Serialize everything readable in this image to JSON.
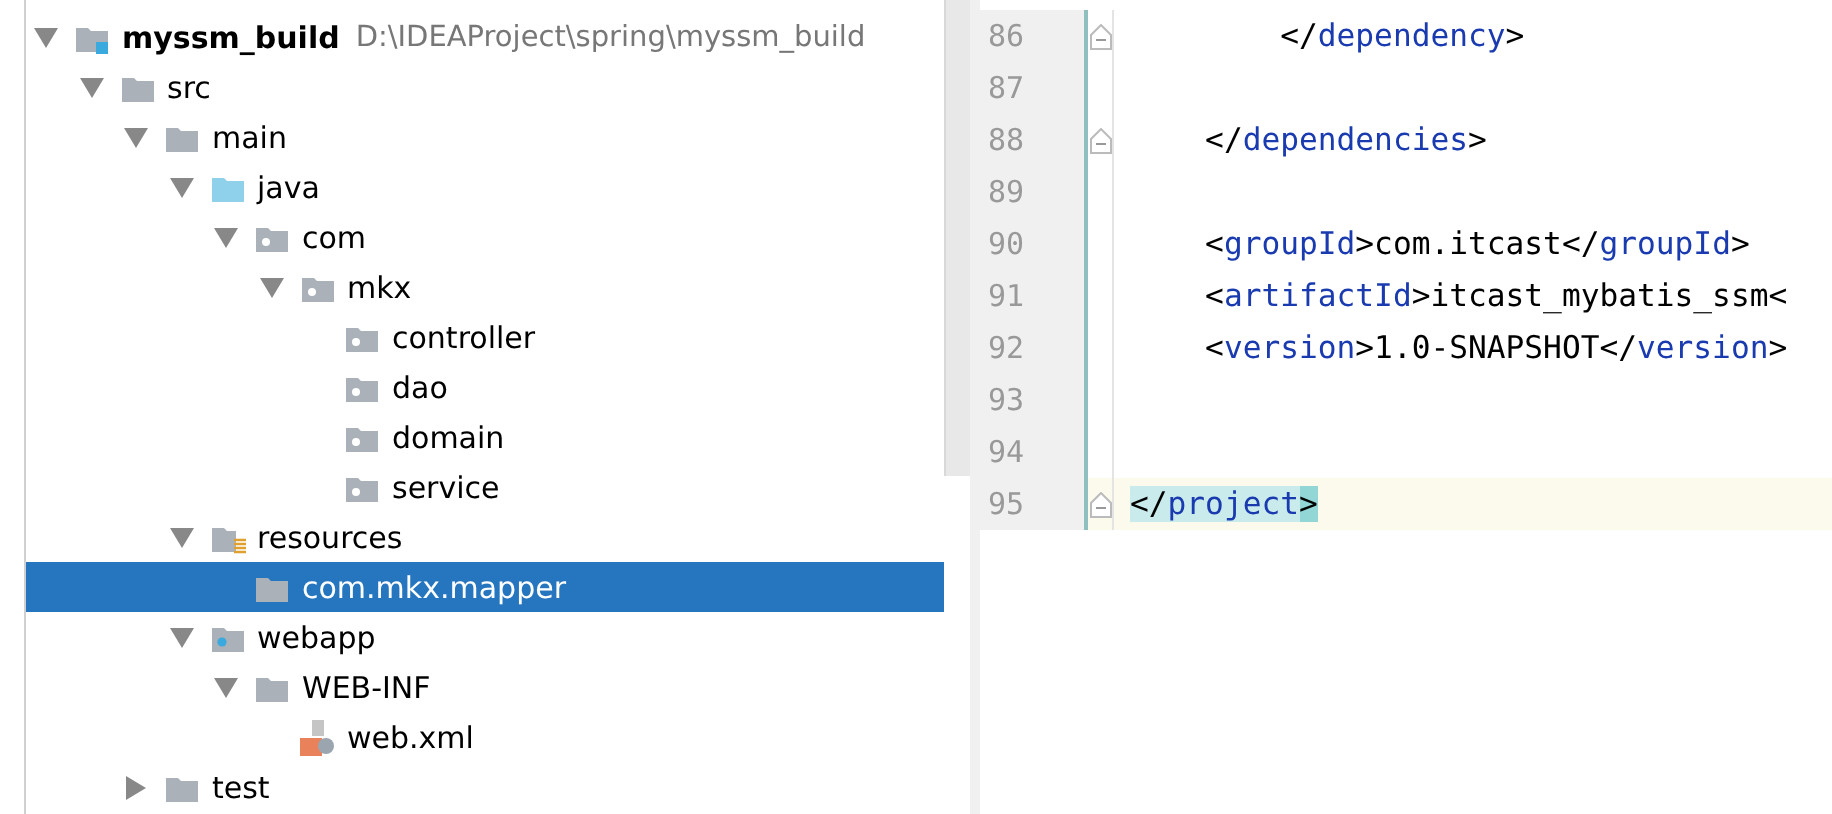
{
  "project_tree": {
    "items": [
      {
        "label": "myssm_build",
        "path": "D:\\IDEAProject\\spring\\myssm_build",
        "kind": "module",
        "expanded": true,
        "selected": false,
        "children": [
          {
            "label": "src",
            "kind": "folder",
            "expanded": true,
            "selected": false,
            "children": [
              {
                "label": "main",
                "kind": "folder",
                "expanded": true,
                "selected": false,
                "children": [
                  {
                    "label": "java",
                    "kind": "source",
                    "expanded": true,
                    "selected": false,
                    "children": [
                      {
                        "label": "com",
                        "kind": "package",
                        "expanded": true,
                        "selected": false,
                        "children": [
                          {
                            "label": "mkx",
                            "kind": "package",
                            "expanded": true,
                            "selected": false,
                            "children": [
                              {
                                "label": "controller",
                                "kind": "package",
                                "selected": false
                              },
                              {
                                "label": "dao",
                                "kind": "package",
                                "selected": false
                              },
                              {
                                "label": "domain",
                                "kind": "package",
                                "selected": false
                              },
                              {
                                "label": "service",
                                "kind": "package",
                                "selected": false
                              }
                            ]
                          }
                        ]
                      }
                    ]
                  },
                  {
                    "label": "resources",
                    "kind": "resources",
                    "expanded": true,
                    "selected": false,
                    "children": [
                      {
                        "label": "com.mkx.mapper",
                        "kind": "folder",
                        "selected": true
                      }
                    ]
                  },
                  {
                    "label": "webapp",
                    "kind": "webapp",
                    "expanded": true,
                    "selected": false,
                    "children": [
                      {
                        "label": "WEB-INF",
                        "kind": "folder",
                        "expanded": true,
                        "selected": false,
                        "children": [
                          {
                            "label": "web.xml",
                            "kind": "xml",
                            "selected": false
                          }
                        ]
                      }
                    ]
                  }
                ]
              },
              {
                "label": "test",
                "kind": "folder",
                "expanded": false,
                "selected": false
              }
            ]
          }
        ]
      }
    ]
  },
  "editor": {
    "lines": [
      {
        "number": "86",
        "fold": true,
        "current": false,
        "segments": [
          {
            "kind": "text",
            "text": "        </"
          },
          {
            "kind": "tag",
            "text": "dependency"
          },
          {
            "kind": "text",
            "text": ">"
          }
        ]
      },
      {
        "number": "87",
        "fold": false,
        "current": false
      },
      {
        "number": "88",
        "fold": true,
        "current": false,
        "segments": [
          {
            "kind": "text",
            "text": "    </"
          },
          {
            "kind": "tag",
            "text": "dependencies"
          },
          {
            "kind": "text",
            "text": ">"
          }
        ]
      },
      {
        "number": "89",
        "fold": false,
        "current": false
      },
      {
        "number": "90",
        "fold": false,
        "current": false,
        "segments": [
          {
            "kind": "text",
            "text": "    <"
          },
          {
            "kind": "tag",
            "text": "groupId"
          },
          {
            "kind": "text",
            "text": ">com.itcast</"
          },
          {
            "kind": "tag",
            "text": "groupId"
          },
          {
            "kind": "text",
            "text": ">"
          }
        ]
      },
      {
        "number": "91",
        "fold": false,
        "current": false,
        "segments": [
          {
            "kind": "text",
            "text": "    <"
          },
          {
            "kind": "tag",
            "text": "artifactId"
          },
          {
            "kind": "text",
            "text": ">itcast_mybatis_ssm<"
          }
        ]
      },
      {
        "number": "92",
        "fold": false,
        "current": false,
        "segments": [
          {
            "kind": "text",
            "text": "    <"
          },
          {
            "kind": "tag",
            "text": "version"
          },
          {
            "kind": "text",
            "text": ">1.0-SNAPSHOT</"
          },
          {
            "kind": "tag",
            "text": "version"
          },
          {
            "kind": "text",
            "text": ">"
          }
        ]
      },
      {
        "number": "93",
        "fold": false,
        "current": false
      },
      {
        "number": "94",
        "fold": false,
        "current": false
      },
      {
        "number": "95",
        "fold": true,
        "current": true,
        "segments": [
          {
            "kind": "match",
            "text": "</"
          },
          {
            "kind": "match-tag",
            "text": "project"
          },
          {
            "kind": "match-end",
            "text": ">"
          }
        ]
      }
    ]
  }
}
